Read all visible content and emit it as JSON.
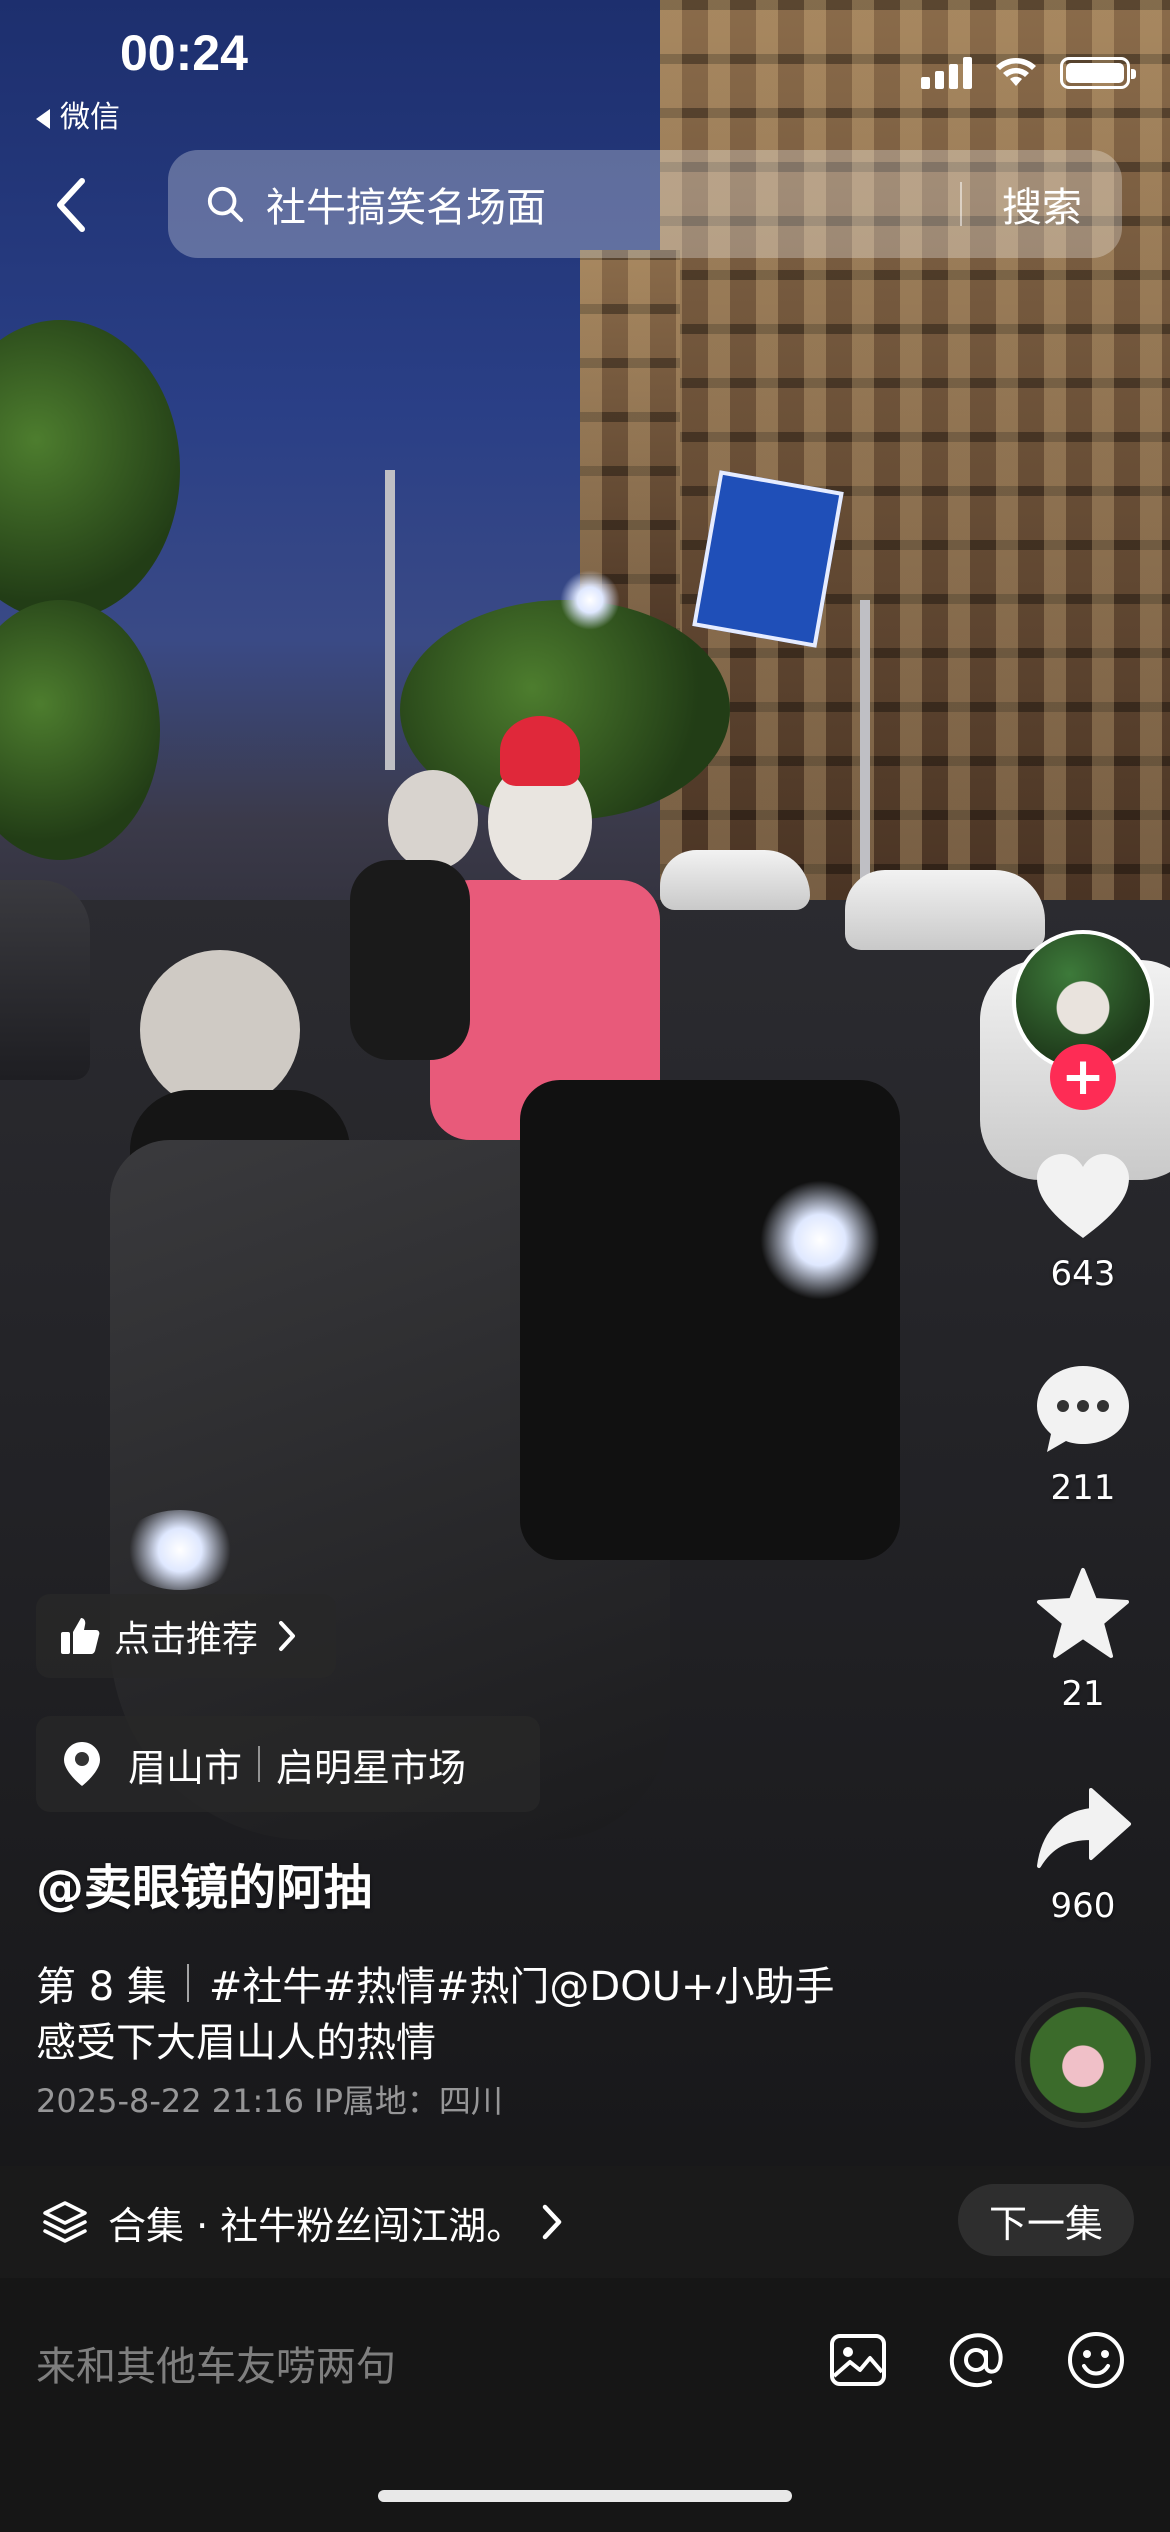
{
  "status_bar": {
    "time": "00:24",
    "back_app": "微信"
  },
  "search": {
    "query": "社牛搞笑名场面",
    "button": "搜索"
  },
  "right_rail": {
    "like_count": "643",
    "comment_count": "211",
    "favorite_count": "21",
    "share_count": "960"
  },
  "info": {
    "recommend_label": "点击推荐",
    "location_city": "眉山市",
    "location_place": "启明星市场",
    "author": "@卖眼镜的阿抽",
    "episode": "第 8 集",
    "tags": "#社牛#热情#热门@DOU+小助手",
    "description": "感受下大眉山人的热情",
    "meta": "2025-8-22 21:16  IP属地：四川"
  },
  "collection": {
    "title": "合集 · 社牛粉丝闯江湖。",
    "next_label": "下一集"
  },
  "comment": {
    "placeholder": "来和其他车友唠两句"
  },
  "colors": {
    "follow_red": "#fe2c55",
    "bar_bg": "#1a1a1a"
  }
}
